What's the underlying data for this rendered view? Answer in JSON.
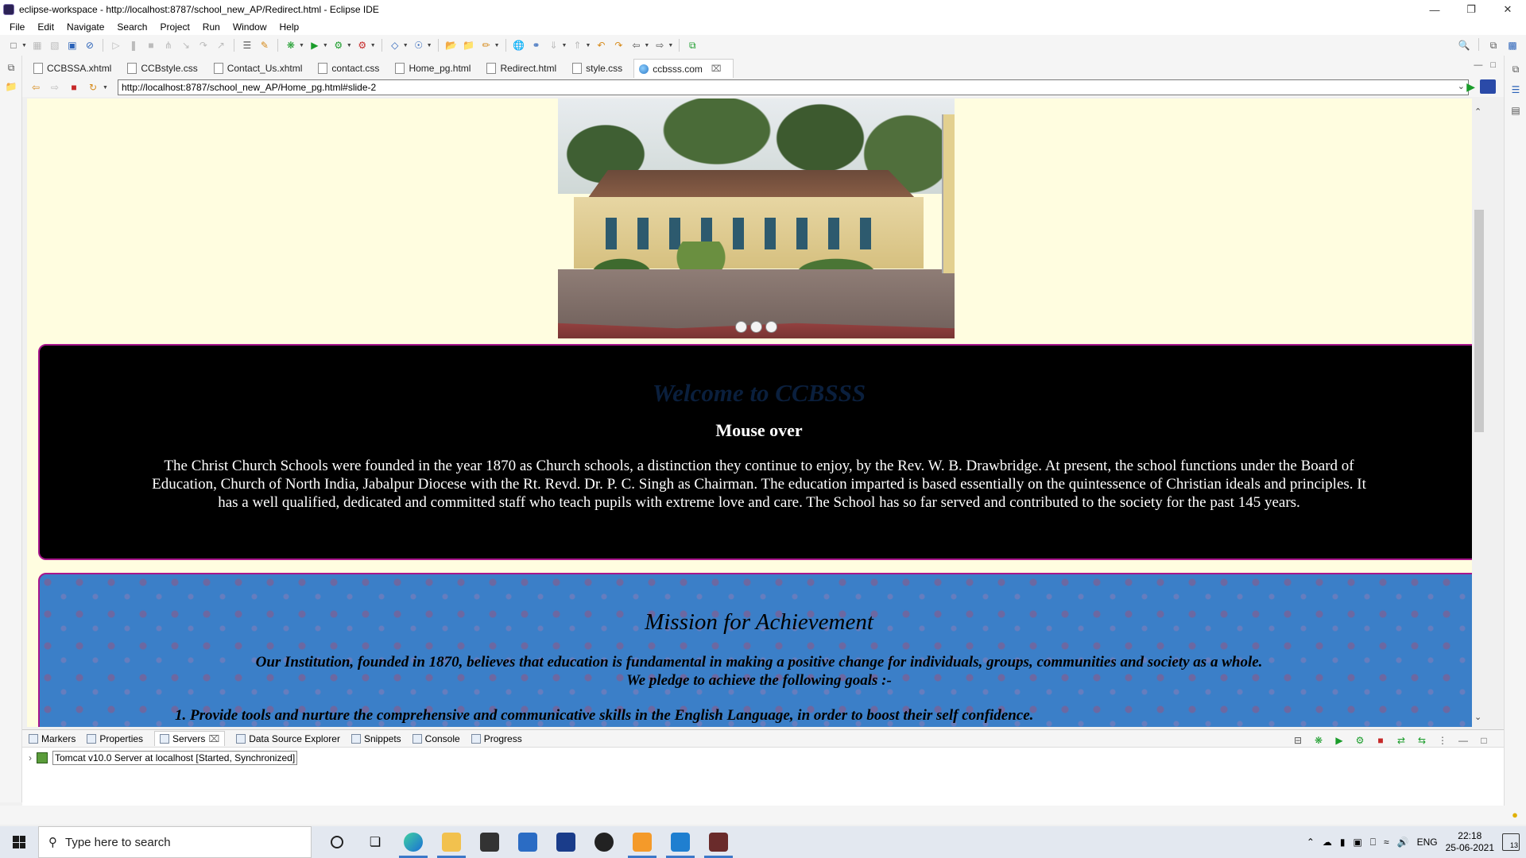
{
  "window": {
    "title": "eclipse-workspace - http://localhost:8787/school_new_AP/Redirect.html - Eclipse IDE"
  },
  "menu": [
    "File",
    "Edit",
    "Navigate",
    "Search",
    "Project",
    "Run",
    "Window",
    "Help"
  ],
  "editor_tabs": [
    {
      "label": "CCBSSA.xhtml",
      "icon": "file-icon"
    },
    {
      "label": "CCBstyle.css",
      "icon": "file-icon"
    },
    {
      "label": "Contact_Us.xhtml",
      "icon": "file-icon"
    },
    {
      "label": "contact.css",
      "icon": "file-icon"
    },
    {
      "label": "Home_pg.html",
      "icon": "file-icon"
    },
    {
      "label": "Redirect.html",
      "icon": "file-icon"
    },
    {
      "label": "style.css",
      "icon": "file-icon"
    },
    {
      "label": "ccbsss.com",
      "icon": "globe-icon",
      "active": true
    }
  ],
  "browser": {
    "url": "http://localhost:8787/school_new_AP/Home_pg.html#slide-2"
  },
  "page": {
    "slider_dots": 3,
    "welcome": {
      "title": "Welcome to CCBSSS",
      "subtitle": "Mouse over",
      "body": "The Christ Church Schools were founded in the year 1870 as Church schools, a distinction they continue to enjoy, by the Rev. W. B. Drawbridge. At present, the school functions under the Board of Education, Church of North India, Jabalpur Diocese with the Rt. Revd. Dr. P. C. Singh as Chairman. The education imparted is based essentially on the quintessence of Christian ideals and principles. It has a well qualified, dedicated and committed staff who teach pupils with extreme love and care. The School has so far served and contributed to the society for the past 145 years."
    },
    "mission": {
      "title": "Mission for Achievement",
      "body_line1": "Our Institution, founded in 1870, believes that education is fundamental in making a positive change for individuals, groups, communities and society as a whole.",
      "body_line2": "We pledge to achieve the following goals :-",
      "goal1": "1.  Provide tools and nurture the comprehensive and communicative skills in the English Language, in order to boost their self confidence."
    }
  },
  "bottom_panel": {
    "tabs": [
      "Markers",
      "Properties",
      "Servers",
      "Data Source Explorer",
      "Snippets",
      "Console",
      "Progress"
    ],
    "server_entry": "Tomcat v10.0 Server at localhost  [Started, Synchronized]"
  },
  "taskbar": {
    "search_placeholder": "Type here to search",
    "language": "ENG",
    "time": "22:18",
    "date": "25-06-2021",
    "notification_count": "13"
  },
  "colors": {
    "page_background": "#fffde0",
    "box_border": "#a8168c",
    "mission_background": "#3b7fc8"
  }
}
